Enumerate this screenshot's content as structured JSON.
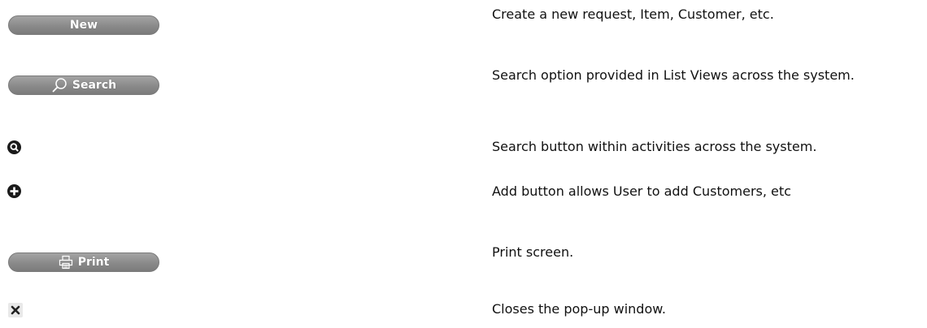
{
  "rows": [
    {
      "control": {
        "type": "pill-button",
        "label": "New",
        "icon": ""
      },
      "description": "Create a new request, Item, Customer, etc."
    },
    {
      "control": {
        "type": "pill-button",
        "label": "Search",
        "icon": "magnifier-icon"
      },
      "description": "Search option provided in List Views across the system."
    },
    {
      "control": {
        "type": "round-icon",
        "icon": "search-icon"
      },
      "description": "Search button within activities across the system."
    },
    {
      "control": {
        "type": "round-icon",
        "icon": "add-icon"
      },
      "description": "Add button allows User to add Customers, etc"
    },
    {
      "control": {
        "type": "pill-button",
        "label": "Print",
        "icon": "printer-icon"
      },
      "description": "Print screen."
    },
    {
      "control": {
        "type": "square-icon",
        "icon": "close-icon"
      },
      "description": "Closes the pop-up window."
    }
  ],
  "colors": {
    "button_gradient_top": "#a3a3a3",
    "button_gradient_bottom": "#7b7b7b",
    "button_text": "#ffffff",
    "icon_dark": "#1a1a1a",
    "close_bg": "#e9e9e9"
  }
}
